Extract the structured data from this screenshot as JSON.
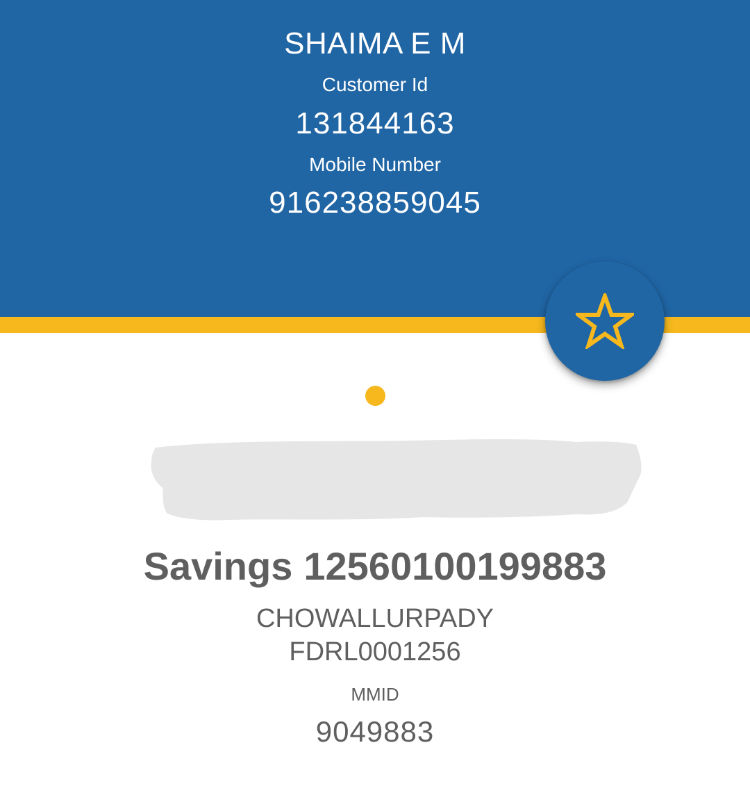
{
  "colors": {
    "header_bg": "#2065a4",
    "accent": "#f6b81d",
    "text_grey": "#5f5f5f",
    "redaction": "#e6e6e6"
  },
  "profile": {
    "name": "SHAIMA E M",
    "customer_id_label": "Customer Id",
    "customer_id": "131844163",
    "mobile_label": "Mobile Number",
    "mobile_number": "916238859045"
  },
  "favorite_button": {
    "icon": "star-outline-icon"
  },
  "account": {
    "type": "Savings",
    "number": "12560100199883",
    "branch_name": "CHOWALLURPADY",
    "ifsc": "FDRL0001256",
    "mmid_label": "MMID",
    "mmid": "9049883"
  }
}
